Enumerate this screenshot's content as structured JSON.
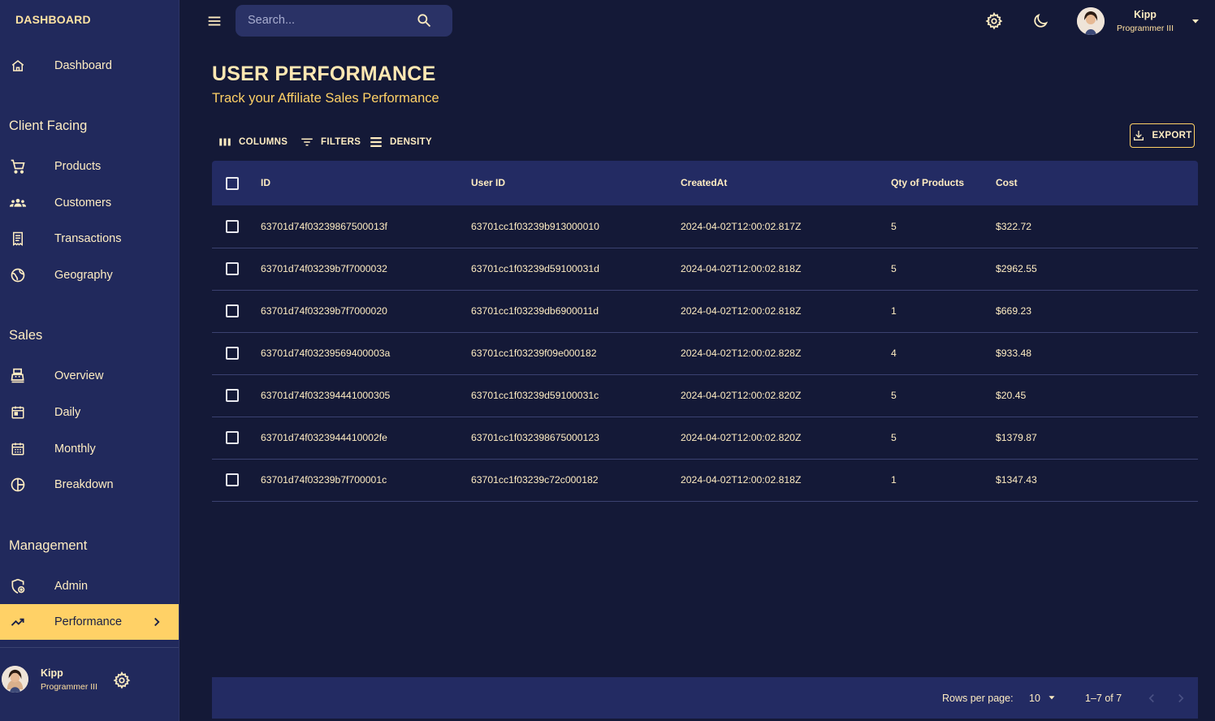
{
  "brand": "DASHBOARD",
  "sidebar": {
    "top_item": {
      "label": "Dashboard",
      "icon": "home-icon"
    },
    "sections": [
      {
        "title": "Client Facing",
        "items": [
          {
            "label": "Products",
            "icon": "shopping-cart-icon"
          },
          {
            "label": "Customers",
            "icon": "groups-icon"
          },
          {
            "label": "Transactions",
            "icon": "receipt-icon"
          },
          {
            "label": "Geography",
            "icon": "globe-icon"
          }
        ]
      },
      {
        "title": "Sales",
        "items": [
          {
            "label": "Overview",
            "icon": "point-of-sale-icon"
          },
          {
            "label": "Daily",
            "icon": "today-icon"
          },
          {
            "label": "Monthly",
            "icon": "calendar-month-icon"
          },
          {
            "label": "Breakdown",
            "icon": "pie-chart-icon"
          }
        ]
      },
      {
        "title": "Management",
        "items": [
          {
            "label": "Admin",
            "icon": "admin-panel-icon"
          },
          {
            "label": "Performance",
            "icon": "trending-up-icon",
            "active": true
          }
        ]
      }
    ],
    "footer": {
      "name": "Kipp",
      "role": "Programmer III"
    }
  },
  "topbar": {
    "search_placeholder": "Search...",
    "user": {
      "name": "Kipp",
      "role": "Programmer III"
    }
  },
  "header": {
    "title": "USER PERFORMANCE",
    "subtitle": "Track your Affiliate Sales Performance"
  },
  "toolbar": {
    "columns": "COLUMNS",
    "filters": "FILTERS",
    "density": "DENSITY",
    "export": "EXPORT"
  },
  "table": {
    "columns": [
      "ID",
      "User ID",
      "CreatedAt",
      "Qty of Products",
      "Cost"
    ],
    "rows": [
      [
        "63701d74f03239867500013f",
        "63701cc1f03239b913000010",
        "2024-04-02T12:00:02.817Z",
        "5",
        "$322.72"
      ],
      [
        "63701d74f03239b7f7000032",
        "63701cc1f03239d59100031d",
        "2024-04-02T12:00:02.818Z",
        "5",
        "$2962.55"
      ],
      [
        "63701d74f03239b7f7000020",
        "63701cc1f03239db6900011d",
        "2024-04-02T12:00:02.818Z",
        "1",
        "$669.23"
      ],
      [
        "63701d74f03239569400003a",
        "63701cc1f03239f09e000182",
        "2024-04-02T12:00:02.828Z",
        "4",
        "$933.48"
      ],
      [
        "63701d74f032394441000305",
        "63701cc1f03239d59100031c",
        "2024-04-02T12:00:02.820Z",
        "5",
        "$20.45"
      ],
      [
        "63701d74f0323944410002fe",
        "63701cc1f032398675000123",
        "2024-04-02T12:00:02.820Z",
        "5",
        "$1379.87"
      ],
      [
        "63701d74f03239b7f700001c",
        "63701cc1f03239c72c000182",
        "2024-04-02T12:00:02.818Z",
        "1",
        "$1347.43"
      ]
    ]
  },
  "pagination": {
    "rows_per_page_label": "Rows per page:",
    "rows_per_page": "10",
    "range": "1–7 of 7"
  },
  "colors": {
    "background": "#141937",
    "sidebar": "#21295c",
    "accent": "#ffd166",
    "text": "#ffedc2"
  }
}
